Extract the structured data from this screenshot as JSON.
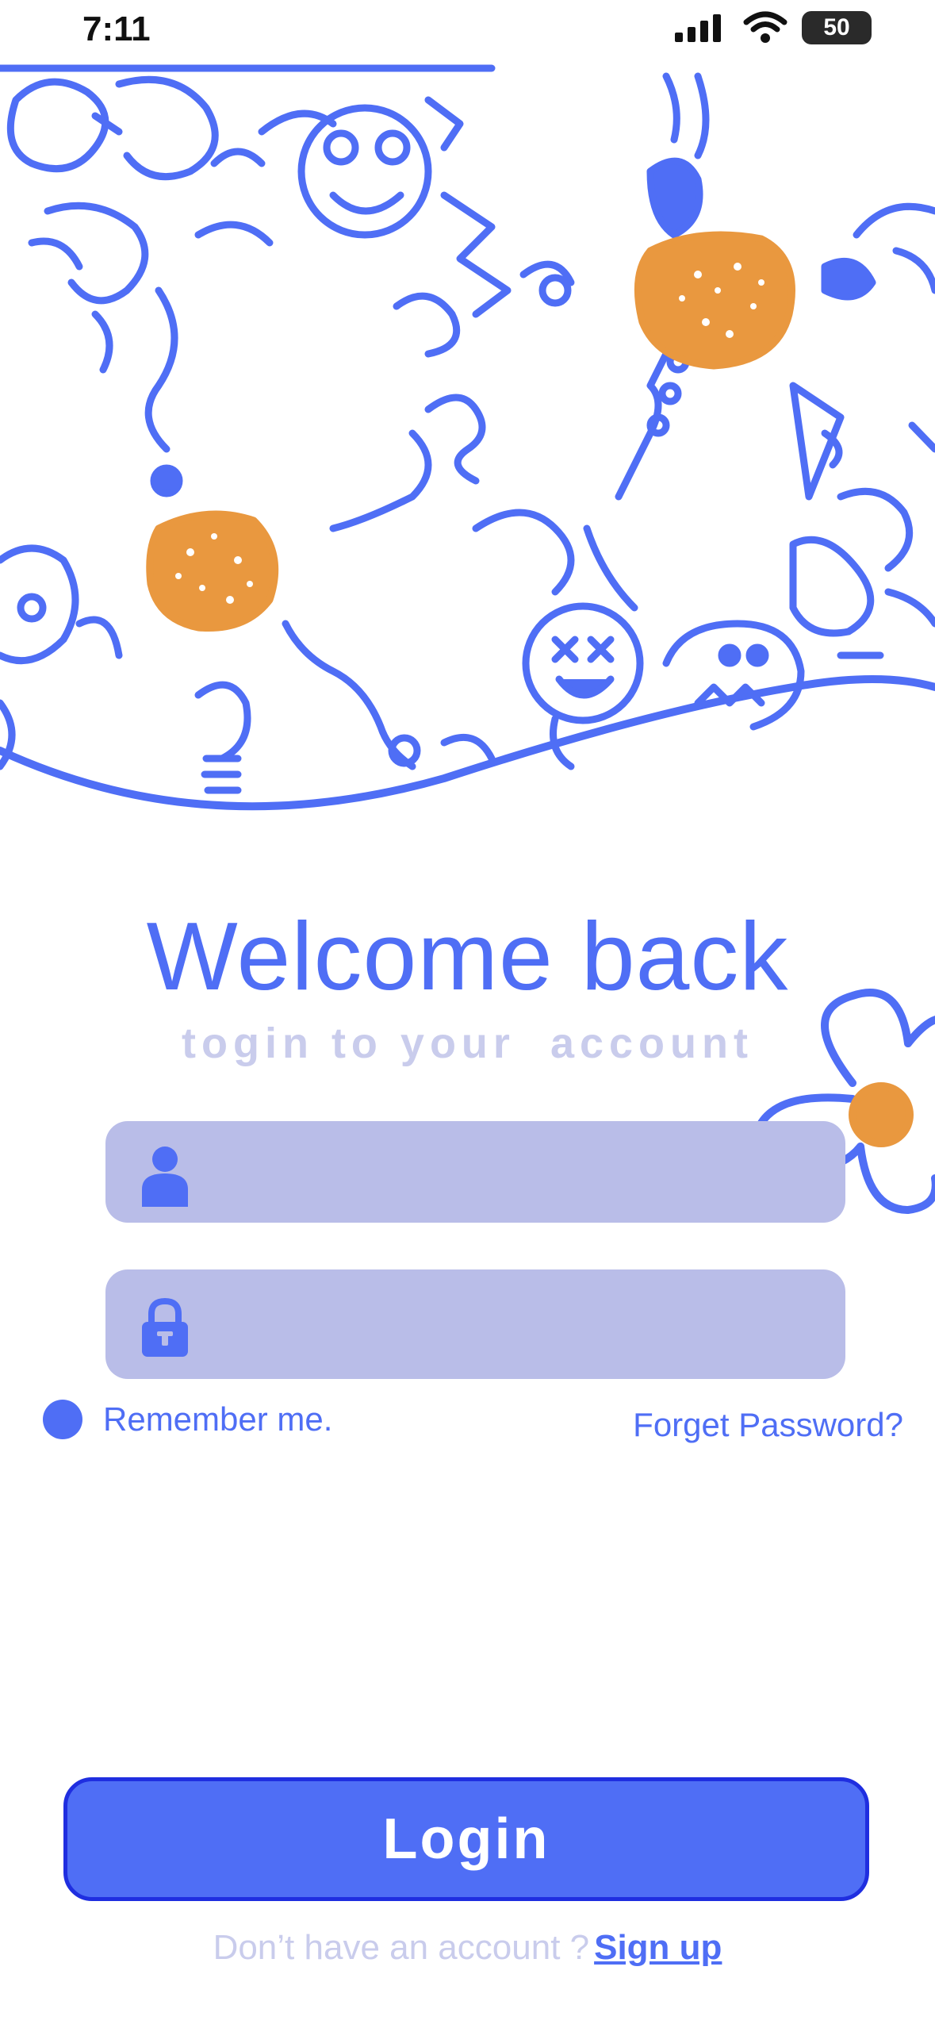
{
  "status_bar": {
    "time": "7:11",
    "battery": "50"
  },
  "login": {
    "title": "Welcome back",
    "subtitle": "togin to your  account",
    "username_placeholder": "",
    "password_placeholder": "",
    "remember_label": "Remember me.",
    "forget_label": "Forget Password?",
    "login_button": "Login",
    "signup_prompt": "Don’t have an account ?",
    "signup_link": "Sign up"
  },
  "colors": {
    "accent": "#4f6ef5",
    "orange": "#e9983f",
    "field_bg": "#b9bde8",
    "muted_text": "#c9ccec"
  },
  "icons": [
    "user-icon",
    "lock-icon",
    "cellular-icon",
    "wifi-icon",
    "battery-icon"
  ]
}
